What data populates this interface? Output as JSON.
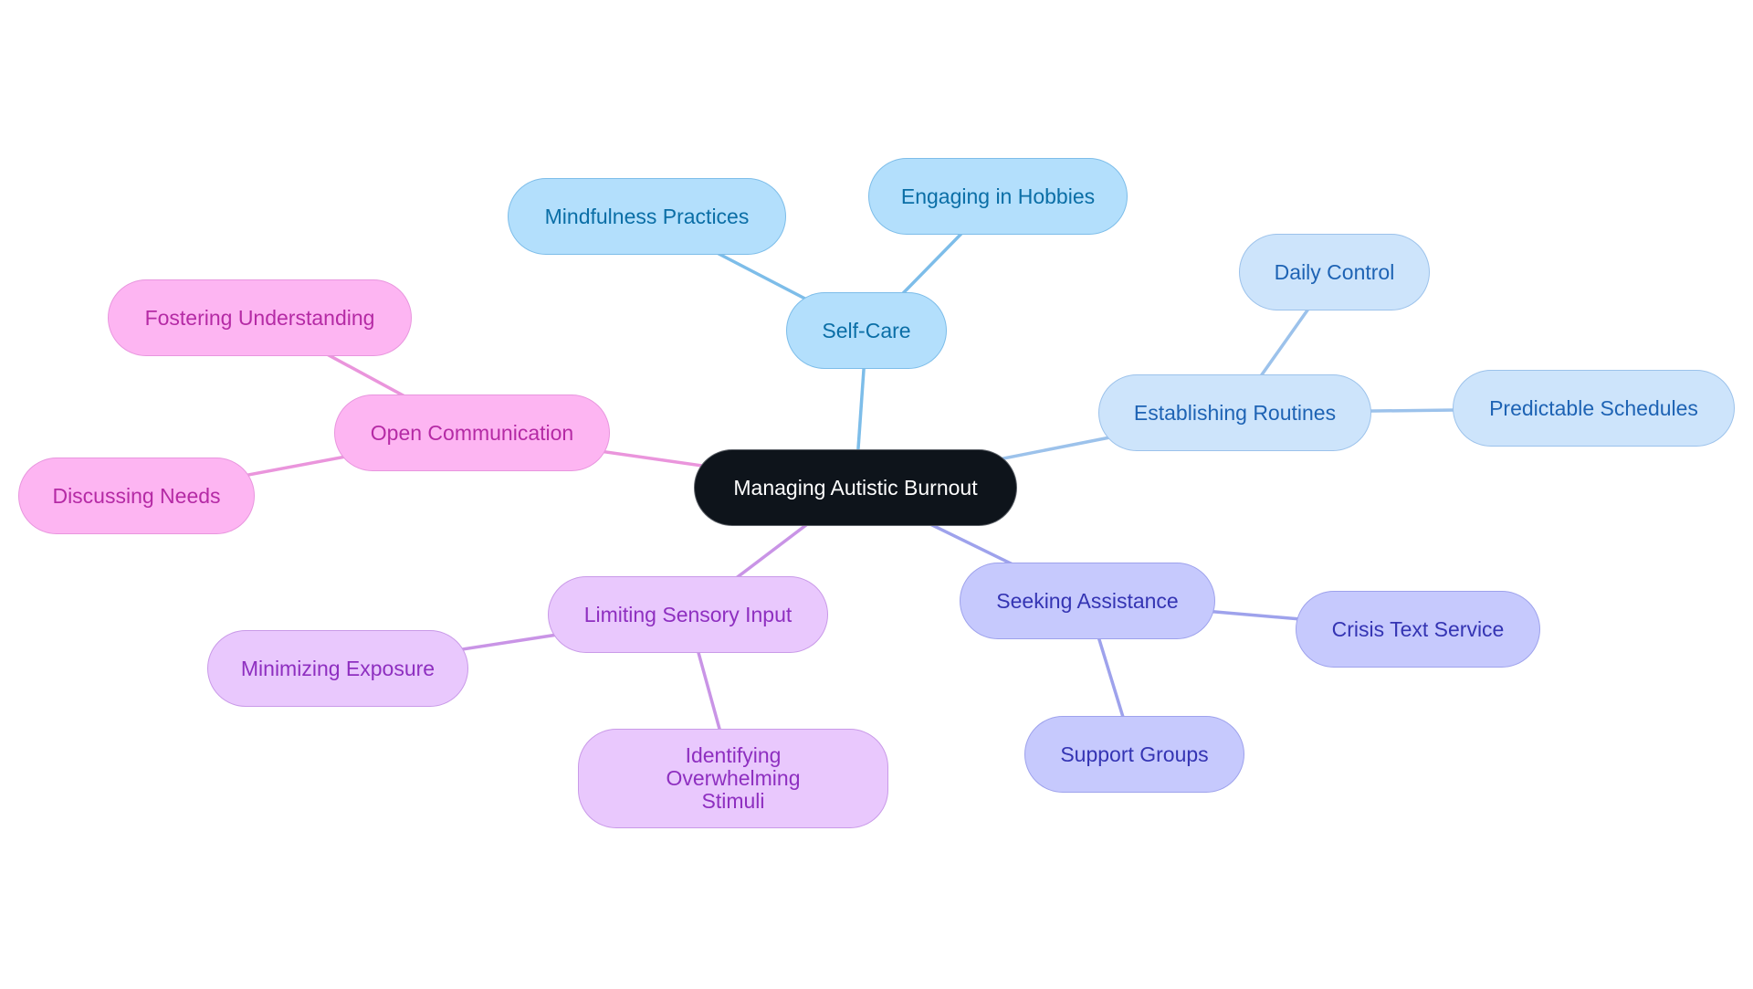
{
  "diagram": {
    "type": "mind-map",
    "root": {
      "id": "root",
      "label": "Managing Autistic Burnout"
    },
    "colors": {
      "root": "#0e141b",
      "selfcare": "#b3dffc",
      "routine": "#cde4fb",
      "comm": "#fdb5f2",
      "sensory": "#e9c8fd",
      "assist": "#c6c9fd",
      "edge_selfcare": "#7dbde9",
      "edge_routine": "#9cc2eb",
      "edge_comm": "#ea95dc",
      "edge_sensory": "#c994e6",
      "edge_assist": "#9ea2ec"
    },
    "branches": [
      {
        "id": "self-care",
        "label": "Self-Care",
        "theme": "selfcare",
        "children": [
          {
            "id": "mindfulness",
            "label": "Mindfulness Practices"
          },
          {
            "id": "hobbies",
            "label": "Engaging in Hobbies"
          }
        ]
      },
      {
        "id": "routines",
        "label": "Establishing Routines",
        "theme": "routine",
        "children": [
          {
            "id": "daily-control",
            "label": "Daily Control"
          },
          {
            "id": "schedules",
            "label": "Predictable Schedules"
          }
        ]
      },
      {
        "id": "communication",
        "label": "Open Communication",
        "theme": "comm",
        "children": [
          {
            "id": "fostering",
            "label": "Fostering Understanding"
          },
          {
            "id": "discussing",
            "label": "Discussing Needs"
          }
        ]
      },
      {
        "id": "sensory",
        "label": "Limiting Sensory Input",
        "theme": "sensory",
        "children": [
          {
            "id": "minimizing",
            "label": "Minimizing Exposure"
          },
          {
            "id": "identifying",
            "label": "Identifying Overwhelming Stimuli"
          }
        ]
      },
      {
        "id": "assistance",
        "label": "Seeking Assistance",
        "theme": "assist",
        "children": [
          {
            "id": "crisis",
            "label": "Crisis Text Service"
          },
          {
            "id": "support",
            "label": "Support Groups"
          }
        ]
      }
    ]
  }
}
